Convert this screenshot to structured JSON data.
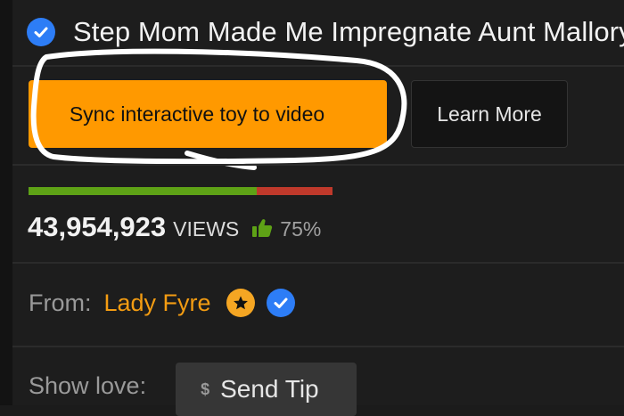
{
  "video": {
    "title": "Step Mom Made Me Impregnate Aunt Mallory",
    "views_count": "43,954,923",
    "views_label": "VIEWS",
    "rating_percent": "75%",
    "rating_fraction": 0.75
  },
  "actions": {
    "sync_label": "Sync interactive toy to video",
    "learn_more_label": "Learn More"
  },
  "uploader": {
    "from_label": "From:",
    "name": "Lady Fyre"
  },
  "support": {
    "show_love_label": "Show love:",
    "tip_currency": "$",
    "tip_label": "Send Tip"
  },
  "icons": {
    "verified": "verified-check-icon",
    "thumb": "thumbs-up-icon",
    "star": "star-badge-icon",
    "dollar": "dollar-icon"
  },
  "colors": {
    "accent_orange": "#ff9900",
    "verified_blue": "#2d7df6",
    "rating_green": "#5ea216",
    "rating_red": "#c0392b",
    "author_orange": "#f39c12"
  }
}
